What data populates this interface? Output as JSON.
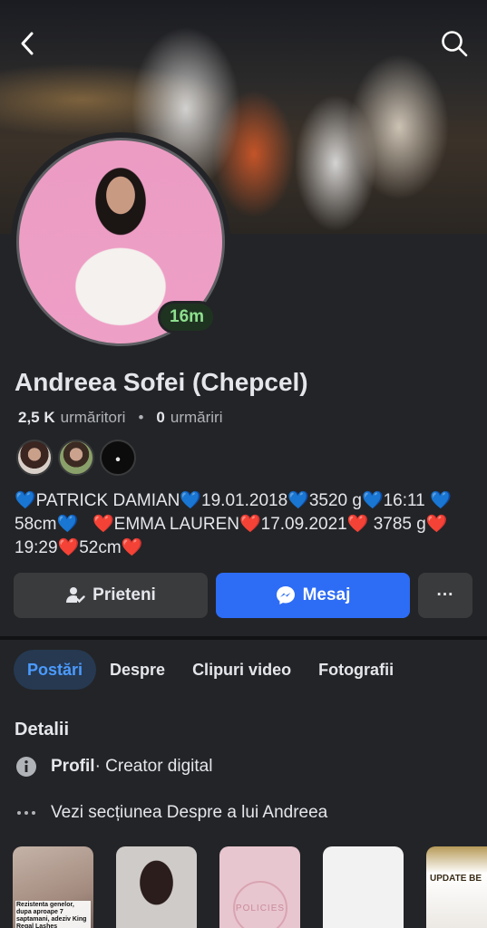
{
  "profile": {
    "name": "Andreea Sofei (Chepcel)",
    "story_badge": "16m",
    "followers_count": "2,5 K",
    "followers_label": "urmăritori",
    "following_count": "0",
    "following_label": "urmăriri"
  },
  "bio": {
    "part1": "PATRICK DAMIAN",
    "part2": "19.01.2018",
    "part3": "3520 g",
    "part4": "16:11",
    "part5": "58cm",
    "part6": "EMMA LAUREN",
    "part7": "17.09.2021",
    "part8": "3785 g",
    "part9": "19:29",
    "part10": "52cm"
  },
  "actions": {
    "friends_label": "Prieteni",
    "message_label": "Mesaj",
    "more_label": "···"
  },
  "tabs": [
    {
      "label": "Postări",
      "active": true
    },
    {
      "label": "Despre",
      "active": false
    },
    {
      "label": "Clipuri video",
      "active": false
    },
    {
      "label": "Fotografii",
      "active": false
    }
  ],
  "details": {
    "title": "Detalii",
    "profile_label": "Profil",
    "profile_value": " · Creator digital",
    "more_text": "Vezi secțiunea Despre a lui Andreea"
  },
  "thumbnails": {
    "t1_caption": "Rezistenta genelor, dupa aproape 7 saptamani, adeziv King Regal Lashes",
    "t3_text": "POLICIES",
    "t5_text": "UPDATE BE"
  },
  "colors": {
    "background": "#232427",
    "accent": "#2d6cf5",
    "active_tab_text": "#4b9bff",
    "story_badge": "#8ee08e"
  }
}
